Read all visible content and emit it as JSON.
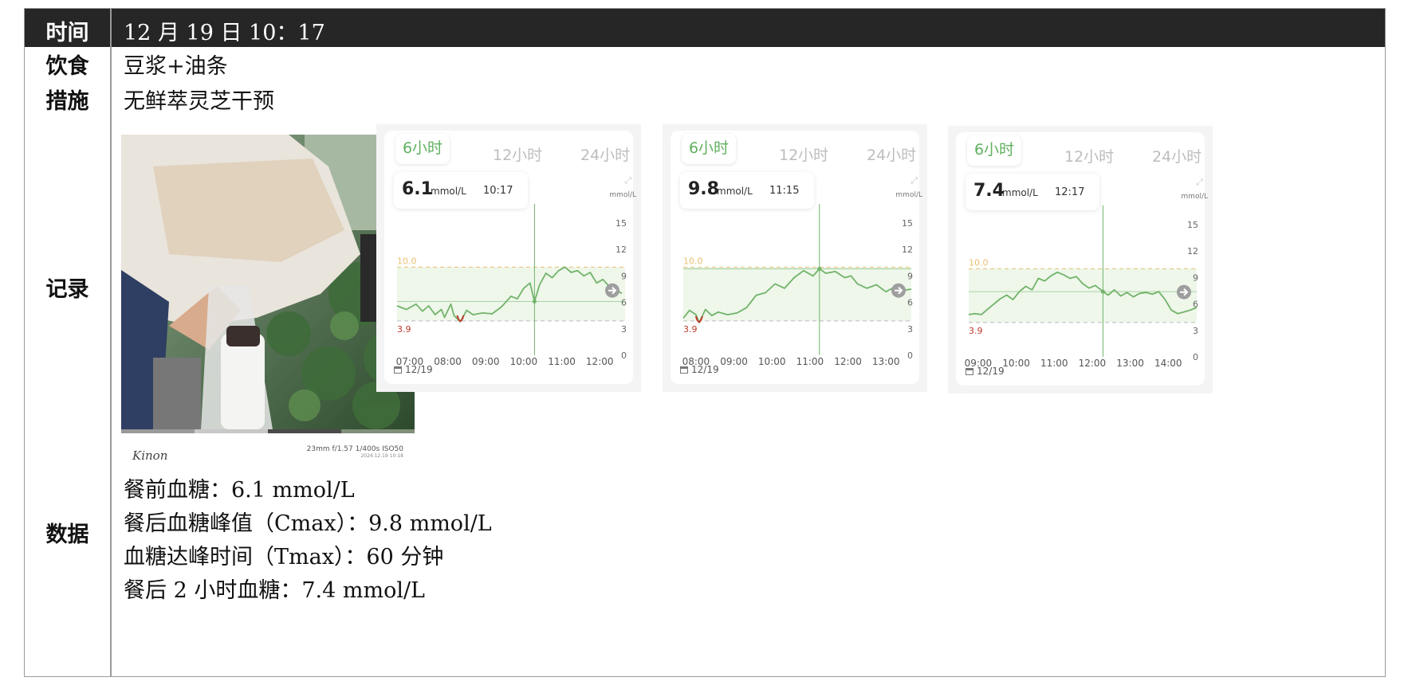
{
  "header": {
    "label": "时间",
    "value": "12 月 19 日 10：17"
  },
  "rows": {
    "diet": {
      "label": "饮食",
      "value": "豆浆+油条"
    },
    "measure": {
      "label": "措施",
      "value": "无鲜萃灵芝干预"
    },
    "record": {
      "label": "记录"
    },
    "data": {
      "label": "数据"
    }
  },
  "photo": {
    "signature": "Kinon",
    "exif": "23mm f/1.57 1/400s ISO50",
    "exif_date": "2024.12.19 10:18"
  },
  "cgm_cards": [
    {
      "tab_active": "6小时",
      "tab_12": "12小时",
      "tab_24": "24小时",
      "reading": "6.1",
      "unit": "mmol/L",
      "time": "10:17",
      "y_unit": "mmol/L",
      "date": "12/19",
      "ticks": [
        "0",
        "3",
        "6",
        "9",
        "12",
        "15"
      ],
      "hi": "10.0",
      "lo": "3.9",
      "x_labels": [
        "07:00",
        "08:00",
        "09:00",
        "10:00",
        "11:00",
        "12:00"
      ],
      "chart_data": {
        "type": "line",
        "x_start": "06:40",
        "x_end": "12:40",
        "cursor_time": "10:17",
        "ylim": [
          0,
          15
        ],
        "target_range": [
          3.9,
          10.0
        ],
        "x": [
          "06:40",
          "06:55",
          "07:10",
          "07:20",
          "07:30",
          "07:40",
          "07:50",
          "07:55",
          "08:05",
          "08:10",
          "08:20",
          "08:30",
          "08:40",
          "08:55",
          "09:10",
          "09:25",
          "09:40",
          "09:50",
          "10:00",
          "10:10",
          "10:17",
          "10:25",
          "10:35",
          "10:45",
          "10:55",
          "11:05",
          "11:15",
          "11:25",
          "11:35",
          "11:45",
          "11:55",
          "12:05",
          "12:15",
          "12:25",
          "12:35"
        ],
        "y": [
          5.6,
          5.2,
          5.8,
          5.0,
          5.6,
          4.6,
          5.2,
          4.3,
          5.8,
          4.5,
          3.8,
          5.1,
          4.6,
          4.8,
          4.7,
          5.5,
          6.7,
          6.4,
          7.6,
          8.2,
          6.1,
          8.0,
          9.3,
          8.8,
          9.6,
          10.0,
          9.4,
          9.6,
          9.0,
          9.4,
          8.2,
          8.6,
          7.8,
          7.5,
          7.0
        ]
      }
    },
    {
      "tab_active": "6小时",
      "tab_12": "12小时",
      "tab_24": "24小时",
      "reading": "9.8",
      "unit": "mmol/L",
      "time": "11:15",
      "y_unit": "mmol/L",
      "date": "12/19",
      "ticks": [
        "0",
        "3",
        "6",
        "9",
        "12",
        "15"
      ],
      "hi": "10.0",
      "lo": "3.9",
      "x_labels": [
        "08:00",
        "09:00",
        "10:00",
        "11:00",
        "12:00",
        "13:00"
      ],
      "chart_data": {
        "type": "line",
        "x_start": "07:40",
        "x_end": "13:40",
        "cursor_time": "11:15",
        "ylim": [
          0,
          15
        ],
        "target_range": [
          3.9,
          10.0
        ],
        "x": [
          "07:40",
          "07:50",
          "08:00",
          "08:05",
          "08:15",
          "08:25",
          "08:35",
          "08:50",
          "09:05",
          "09:20",
          "09:35",
          "09:50",
          "10:05",
          "10:20",
          "10:35",
          "10:50",
          "11:05",
          "11:15",
          "11:25",
          "11:40",
          "11:55",
          "12:05",
          "12:15",
          "12:30",
          "12:45",
          "13:00",
          "13:15",
          "13:30",
          "13:40"
        ],
        "y": [
          4.2,
          5.1,
          4.6,
          3.7,
          5.2,
          4.5,
          4.9,
          4.6,
          4.8,
          5.4,
          6.8,
          7.1,
          8.1,
          7.6,
          8.8,
          9.6,
          9.0,
          9.8,
          9.3,
          9.5,
          8.8,
          9.0,
          8.1,
          7.6,
          8.0,
          7.2,
          7.8,
          7.4,
          7.5
        ]
      }
    },
    {
      "tab_active": "6小时",
      "tab_12": "12小时",
      "tab_24": "24小时",
      "reading": "7.4",
      "unit": "mmol/L",
      "time": "12:17",
      "y_unit": "mmol/L",
      "date": "12/19",
      "ticks": [
        "0",
        "3",
        "6",
        "9",
        "12",
        "15"
      ],
      "hi": "10.0",
      "lo": "3.9",
      "x_labels": [
        "09:00",
        "10:00",
        "11:00",
        "12:00",
        "13:00",
        "14:00"
      ],
      "chart_data": {
        "type": "line",
        "x_start": "08:45",
        "x_end": "14:45",
        "cursor_time": "12:17",
        "ylim": [
          0,
          15
        ],
        "target_range": [
          3.9,
          10.0
        ],
        "x": [
          "08:45",
          "08:55",
          "09:05",
          "09:15",
          "09:25",
          "09:35",
          "09:45",
          "09:55",
          "10:05",
          "10:15",
          "10:25",
          "10:35",
          "10:45",
          "10:55",
          "11:05",
          "11:15",
          "11:25",
          "11:35",
          "11:45",
          "11:55",
          "12:05",
          "12:17",
          "12:25",
          "12:35",
          "12:45",
          "12:55",
          "13:05",
          "13:15",
          "13:25",
          "13:35",
          "13:45",
          "13:55",
          "14:05",
          "14:15",
          "14:25",
          "14:35",
          "14:45"
        ],
        "y": [
          4.8,
          4.9,
          4.8,
          5.4,
          6.0,
          6.6,
          7.0,
          6.5,
          7.4,
          8.0,
          7.6,
          8.9,
          8.6,
          9.2,
          9.6,
          9.3,
          8.9,
          9.1,
          8.3,
          7.8,
          8.1,
          7.4,
          7.0,
          7.6,
          6.9,
          7.3,
          6.8,
          7.2,
          7.3,
          7.1,
          7.4,
          6.5,
          5.3,
          4.9,
          5.1,
          5.3,
          5.6
        ]
      }
    }
  ],
  "data_lines": [
    "餐前血糖：6.1 mmol/L",
    "餐后血糖峰值（Cmax）：9.8 mmol/L",
    "血糖达峰时间（Tmax）：60 分钟",
    "餐后 2 小时血糖：7.4 mmol/L"
  ],
  "colors": {
    "header_bg": "#262626",
    "curve": "#72b36a",
    "hi_line": "#e8c070",
    "lo_mark": "#c0392b"
  }
}
